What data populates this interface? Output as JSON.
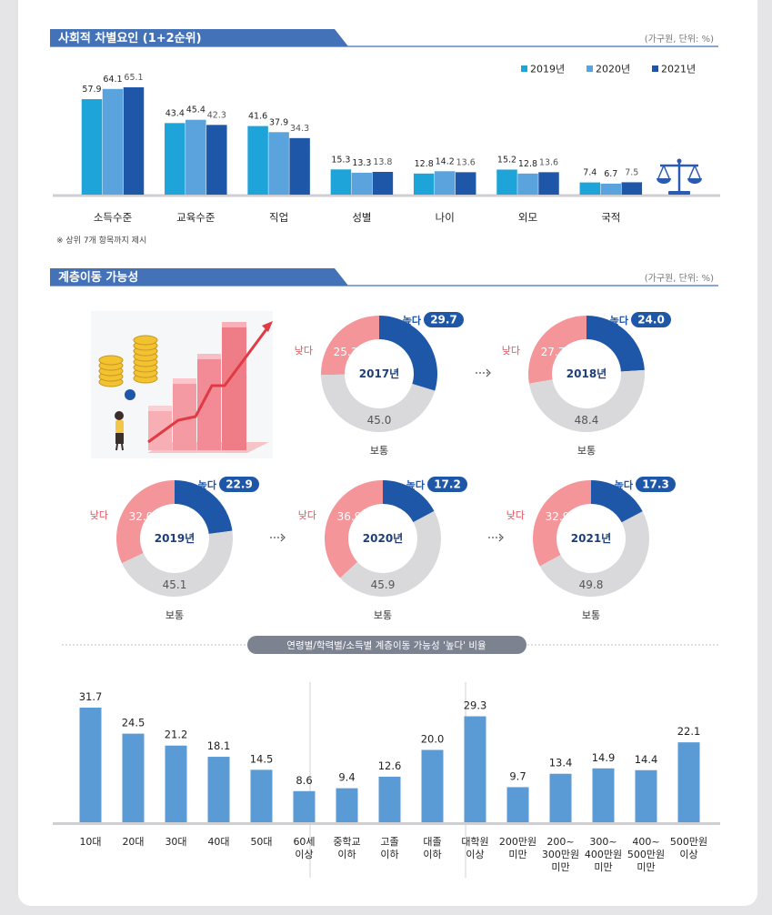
{
  "colors": {
    "banner": "#4472b8",
    "y2019": "#1ea4d8",
    "y2020": "#5aa3dc",
    "y2021": "#1f57a8",
    "high": "#1f57a8",
    "low": "#f4959a",
    "normal": "#d9d9db",
    "bar3": "#5b9bd5"
  },
  "section1": {
    "title": "사회적 차별요인 (1+2순위)",
    "unit": "(가구원, 단위: %)",
    "footnote": "※ 상위 7개 항목까지 제시",
    "icon": "scales-icon"
  },
  "section2": {
    "title": "계층이동 가능성",
    "unit": "(가구원, 단위: %)",
    "illustration": "rising-bar-chart-coins-illustration"
  },
  "section3": {
    "title": "연령별/학력별/소득별 계층이동 가능성 '높다' 비율"
  },
  "chart_data": [
    {
      "type": "bar",
      "title": "사회적 차별요인 (1+2순위)",
      "categories": [
        "소득수준",
        "교육수준",
        "직업",
        "성별",
        "나이",
        "외모",
        "국적"
      ],
      "series": [
        {
          "name": "2019년",
          "values": [
            57.9,
            43.4,
            41.6,
            15.3,
            12.8,
            15.2,
            7.4
          ]
        },
        {
          "name": "2020년",
          "values": [
            64.1,
            45.4,
            37.9,
            13.3,
            14.2,
            12.8,
            6.7
          ]
        },
        {
          "name": "2021년",
          "values": [
            65.1,
            42.3,
            34.3,
            13.8,
            13.6,
            13.6,
            7.5
          ]
        }
      ],
      "ylim": [
        0,
        70
      ],
      "legend": "top-right",
      "grid": false
    },
    {
      "type": "pie",
      "title": "계층이동 가능성",
      "labels": [
        "높다",
        "낮다",
        "보통"
      ],
      "charts": [
        {
          "year": "2017년",
          "values": [
            29.7,
            25.3,
            45.0
          ],
          "value_labels": [
            "29.7",
            "25.3",
            "45.0"
          ]
        },
        {
          "year": "2018년",
          "values": [
            24.0,
            27.7,
            48.4
          ],
          "value_labels": [
            "24.0",
            "27.7",
            "48.4"
          ]
        },
        {
          "year": "2019년",
          "values": [
            22.9,
            32.0,
            45.1
          ],
          "value_labels": [
            "22.9",
            "32.0",
            "45.1"
          ]
        },
        {
          "year": "2020년",
          "values": [
            17.2,
            36.9,
            45.9
          ],
          "value_labels": [
            "17.2",
            "36.9",
            "45.9"
          ]
        },
        {
          "year": "2021년",
          "values": [
            17.3,
            32.9,
            49.8
          ],
          "value_labels": [
            "17.3",
            "32.9",
            "49.8"
          ]
        }
      ]
    },
    {
      "type": "bar",
      "title": "연령별/학력별/소득별 계층이동 가능성 '높다' 비율",
      "categories": [
        "10대",
        "20대",
        "30대",
        "40대",
        "50대",
        "60세\n이상",
        "중학교\n이하",
        "고졸\n이하",
        "대졸\n이하",
        "대학원\n이상",
        "200만원\n미만",
        "200~\n300만원\n미만",
        "300~\n400만원\n미만",
        "400~\n500만원\n미만",
        "500만원\n이상"
      ],
      "values": [
        31.7,
        24.5,
        21.2,
        18.1,
        14.5,
        8.6,
        9.4,
        12.6,
        20.0,
        29.3,
        9.7,
        13.4,
        14.9,
        14.4,
        22.1
      ],
      "value_labels": [
        "31.7",
        "24.5",
        "21.2",
        "18.1",
        "14.5",
        "8.6",
        "9.4",
        "12.6",
        "20.0",
        "29.3",
        "9.7",
        "13.4",
        "14.9",
        "14.4",
        "22.1"
      ],
      "ylim": [
        0,
        35
      ],
      "grid": false
    }
  ]
}
